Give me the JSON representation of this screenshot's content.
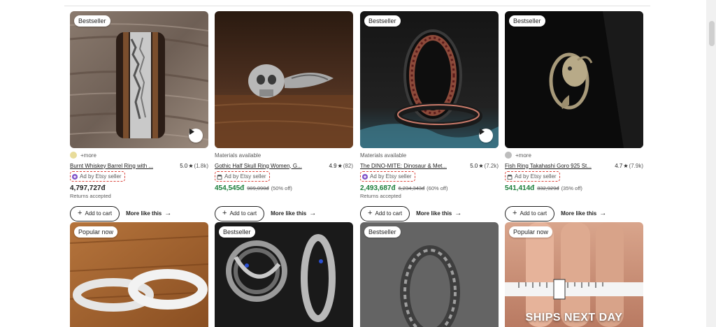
{
  "colors": {
    "sale_price": "#1b7e3b",
    "ad_highlight_border": "#d9443b",
    "text_primary": "#222222",
    "text_secondary": "#595959"
  },
  "listings": [
    {
      "badge": "Bestseller",
      "meta": "+more",
      "swatch_color": "#e8dc9a",
      "title": "Burnt Whiskey Barrel Ring with ...",
      "rating": "5.0",
      "rating_count": "(1.8k)",
      "ad_label": "Ad by Etsy seller",
      "ad_icon": "star-seller-icon",
      "price": "4,797,727đ",
      "original_price": "",
      "discount": "",
      "returns": "Returns accepted",
      "add_to_cart": "Add to cart",
      "more_like_this": "More like this",
      "has_video": true
    },
    {
      "badge": "",
      "meta": "Materials available",
      "swatch_color": "",
      "title": "Gothic Half Skull Ring Women, G...",
      "rating": "4.9",
      "rating_count": "(82)",
      "ad_label": "Ad by Etsy seller",
      "ad_icon": "shop-icon",
      "price": "454,545đ",
      "original_price": "909,090đ",
      "discount": "(50% off)",
      "returns": "",
      "add_to_cart": "Add to cart",
      "more_like_this": "More like this",
      "has_video": false
    },
    {
      "badge": "Bestseller",
      "meta": "Materials available",
      "swatch_color": "",
      "title": "The DINO-MITE: Dinosaur & Met...",
      "rating": "5.0",
      "rating_count": "(7.2k)",
      "ad_label": "Ad by Etsy seller",
      "ad_icon": "star-seller-icon",
      "price": "2,493,687đ",
      "original_price": "6,234,343đ",
      "discount": "(60% off)",
      "returns": "Returns accepted",
      "add_to_cart": "Add to cart",
      "more_like_this": "More like this",
      "has_video": true
    },
    {
      "badge": "Bestseller",
      "meta": "+more",
      "swatch_color": "#bdbdbd",
      "title": "Fish Ring Takahashi Goro 925 St...",
      "rating": "4.7",
      "rating_count": "(7.9k)",
      "ad_label": "Ad by Etsy seller",
      "ad_icon": "shop-icon",
      "price": "541,414đ",
      "original_price": "832,929đ",
      "discount": "(35% off)",
      "returns": "",
      "add_to_cart": "Add to cart",
      "more_like_this": "More like this",
      "has_video": false
    }
  ],
  "bottom_listings": [
    {
      "badge": "Popular now",
      "overlay_text": ""
    },
    {
      "badge": "Bestseller",
      "overlay_text": ""
    },
    {
      "badge": "Bestseller",
      "overlay_text": ""
    },
    {
      "badge": "Popular now",
      "overlay_text": "SHIPS NEXT DAY"
    }
  ]
}
